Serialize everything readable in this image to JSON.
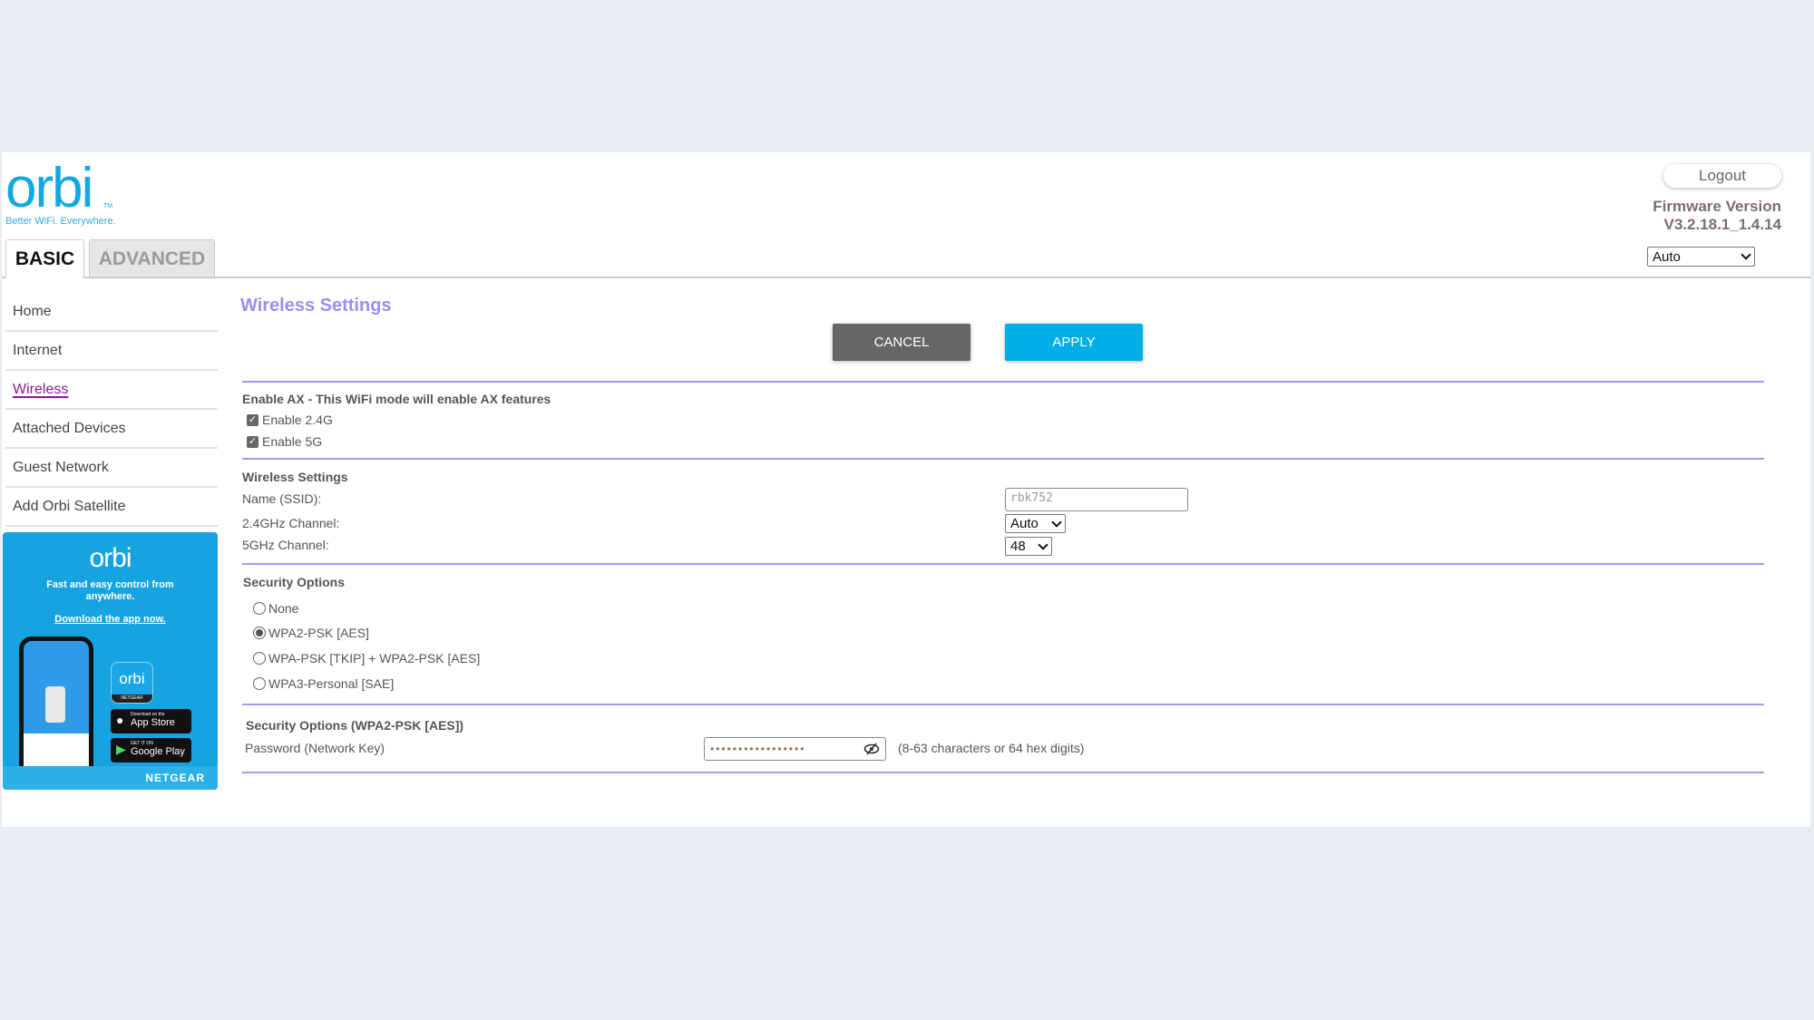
{
  "logo": {
    "wordmark": "orbi",
    "tagline": "Better WiFi. Everywhere."
  },
  "tabs": [
    {
      "label": "BASIC",
      "active": true
    },
    {
      "label": "ADVANCED",
      "active": false
    }
  ],
  "header": {
    "logout_label": "Logout",
    "firmware_label": "Firmware Version",
    "firmware_version": "V3.2.18.1_1.4.14",
    "language_select": "Auto"
  },
  "sidebar": {
    "items": [
      {
        "label": "Home"
      },
      {
        "label": "Internet"
      },
      {
        "label": "Wireless",
        "active": true
      },
      {
        "label": "Attached Devices"
      },
      {
        "label": "Guest Network"
      },
      {
        "label": "Add Orbi Satellite"
      }
    ]
  },
  "promo": {
    "logo": "orbi",
    "text": "Fast and easy control from anywhere.",
    "link": "Download the app now.",
    "app_icon": "orbi",
    "app_store_small": "Download on the",
    "app_store": "App Store",
    "google_small": "GET IT ON",
    "google": "Google Play",
    "brand": "NETGEAR"
  },
  "main": {
    "title": "Wireless Settings",
    "cancel_label": "CANCEL",
    "apply_label": "APPLY",
    "ax": {
      "heading": "Enable AX - This WiFi mode will enable AX features",
      "enable24": "Enable 2.4G",
      "enable5": "Enable 5G",
      "enable24_checked": true,
      "enable5_checked": true
    },
    "wireless": {
      "heading": "Wireless Settings",
      "ssid_label": "Name (SSID):",
      "ssid_value": "rbk752",
      "ch24_label": "2.4GHz Channel:",
      "ch24_value": "Auto",
      "ch5_label": "5GHz Channel:",
      "ch5_value": "48"
    },
    "security": {
      "heading": "Security Options",
      "options": [
        "None",
        "WPA2-PSK [AES]",
        "WPA-PSK [TKIP] + WPA2-PSK [AES]",
        "WPA3-Personal [SAE]"
      ],
      "selected": "WPA2-PSK [AES]"
    },
    "wpa2": {
      "heading": "Security Options (WPA2-PSK [AES])",
      "password_label": "Password (Network Key)",
      "password_masked": "•••••••••••••••••",
      "hint": "(8-63 characters or 64 hex digits)"
    }
  },
  "colors": {
    "accent": "#9b8ef0",
    "apply": "#00aee6",
    "cancel": "#666666",
    "brand": "#13a8e0",
    "active_nav": "#8a1a8a"
  }
}
